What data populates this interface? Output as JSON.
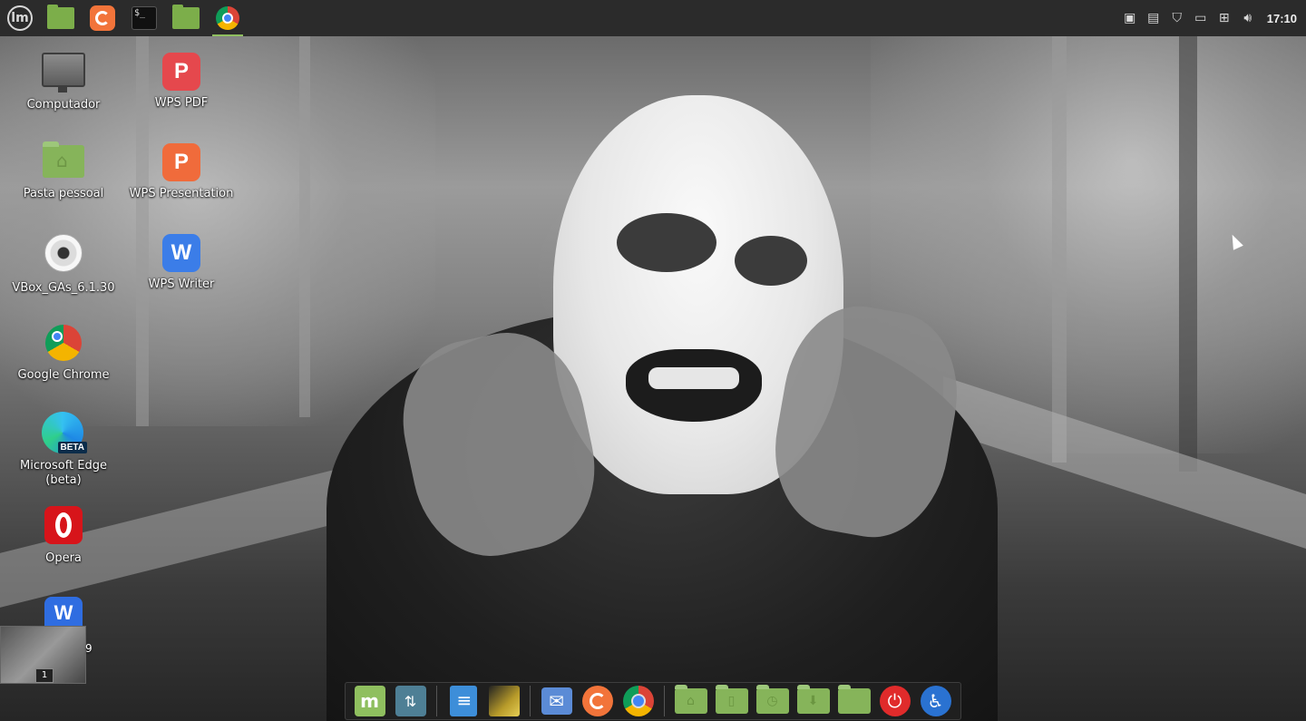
{
  "top_panel": {
    "menu_icon": "linux-mint-menu-icon",
    "pinned_tasks": [
      {
        "name": "files-folder",
        "icon": "folder-icon"
      },
      {
        "name": "firefox",
        "icon": "firefox-icon"
      },
      {
        "name": "terminal",
        "icon": "terminal-icon",
        "glyph": "$_"
      },
      {
        "name": "files-folder-2",
        "icon": "folder-icon"
      },
      {
        "name": "chrome",
        "icon": "chrome-icon",
        "active": true
      }
    ],
    "tray_icons": [
      "camera-icon",
      "clipboard-icon",
      "shield-icon",
      "notes-icon",
      "network-icon",
      "volume-icon"
    ],
    "clock": "17:10"
  },
  "desktop": {
    "icons": [
      {
        "label": "Computador",
        "icon": "computer-icon"
      },
      {
        "label": "Pasta pessoal",
        "icon": "home-folder-icon"
      },
      {
        "label": "VBox_GAs_6.1.30",
        "icon": "disc-icon"
      },
      {
        "label": "Google Chrome",
        "icon": "chrome-icon"
      },
      {
        "label": "Microsoft Edge (beta)",
        "icon": "edge-beta-icon",
        "badge": "BETA"
      },
      {
        "label": "Opera",
        "icon": "opera-icon"
      },
      {
        "label": "WPS PDF",
        "icon": "wps-pdf-icon"
      },
      {
        "label": "WPS Presentation",
        "icon": "wps-presentation-icon"
      },
      {
        "label": "WPS Writer",
        "icon": "wps-writer-icon"
      }
    ],
    "workspace_number": "1",
    "partial_label": "9"
  },
  "dock": {
    "items": [
      "mint-menu-icon",
      "update-manager-icon",
      "text-editor-icon",
      "image-viewer-icon",
      "mail-icon",
      "firefox-icon",
      "chrome-icon",
      "home-folder-icon",
      "documents-folder-icon",
      "recent-folder-icon",
      "downloads-folder-icon",
      "folder-icon",
      "power-icon",
      "accessibility-icon"
    ]
  },
  "colors": {
    "panel_bg": "#2b2b2b",
    "mint_green": "#8fbf5f",
    "active_indicator": "#8fbf5f"
  }
}
